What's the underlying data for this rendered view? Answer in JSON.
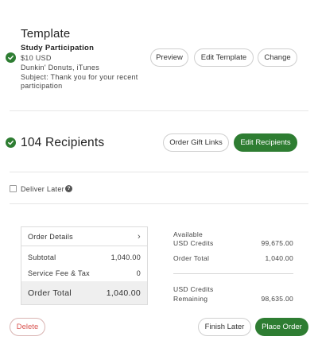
{
  "template": {
    "heading": "Template",
    "name": "Study Participation",
    "amount": "$10 USD",
    "brands": "Dunkin' Donuts, iTunes",
    "subject_line1": "Subject: Thank you for your recent",
    "subject_line2": "participation",
    "preview_label": "Preview",
    "edit_label": "Edit Template",
    "change_label": "Change"
  },
  "recipients": {
    "heading": "104 Recipients",
    "order_links_label": "Order Gift Links",
    "edit_label": "Edit Recipients"
  },
  "deliver_later": {
    "label": "Deliver Later",
    "help": "?"
  },
  "order_details": {
    "header": "Order Details",
    "subtotal_label": "Subtotal",
    "subtotal_value": "1,040.00",
    "fee_label": "Service Fee & Tax",
    "fee_value": "0",
    "total_label": "Order Total",
    "total_value": "1,040.00"
  },
  "credits": {
    "available_line1": "Available",
    "available_line2": "USD Credits",
    "available_value": "99,675.00",
    "order_total_label": "Order Total",
    "order_total_value": "1,040.00",
    "remaining_line1": "USD Credits",
    "remaining_line2": "Remaining",
    "remaining_value": "98,635.00"
  },
  "actions": {
    "delete_label": "Delete",
    "finish_later_label": "Finish Later",
    "place_order_label": "Place Order"
  },
  "colors": {
    "accent": "#2e7d32",
    "danger": "#d9534f"
  }
}
